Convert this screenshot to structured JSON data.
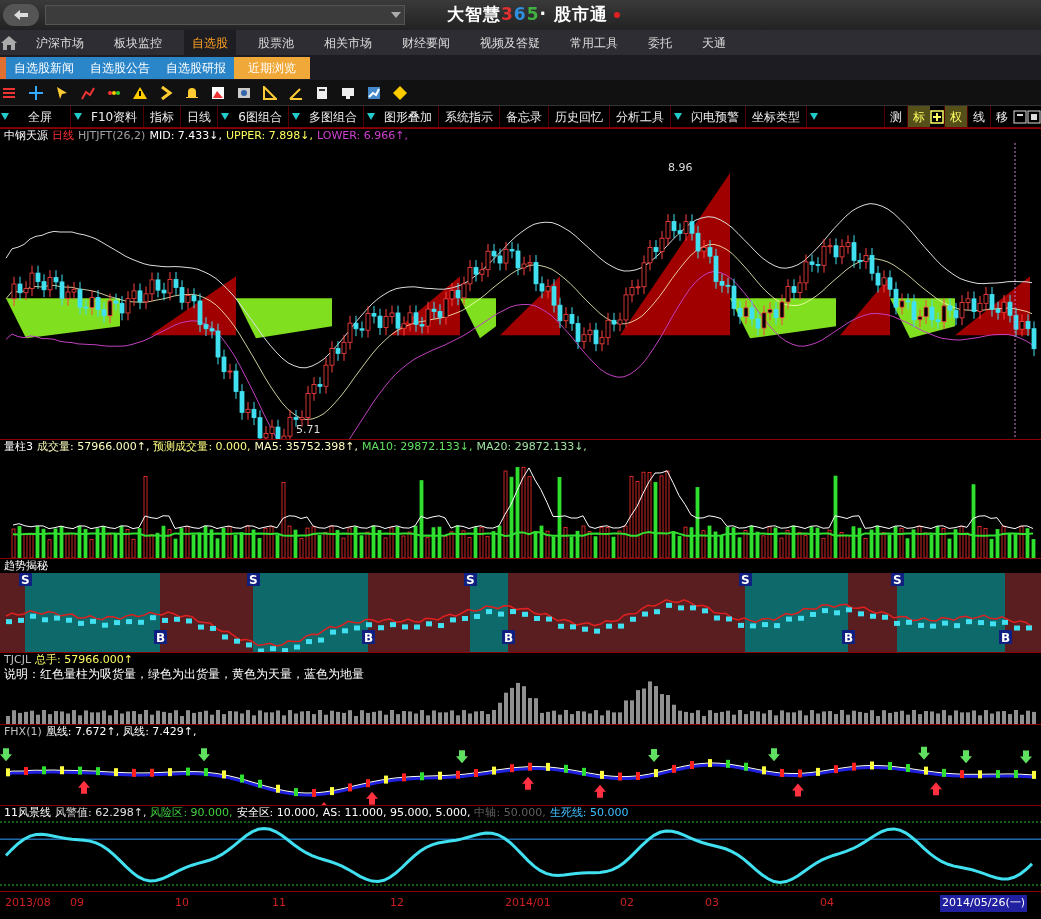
{
  "title_bar": {
    "brand": "大智慧",
    "brand_digits": "365",
    "brand_tail": "· 股市通"
  },
  "nav": [
    {
      "label": "沪深市场",
      "selected": false
    },
    {
      "label": "板块监控",
      "selected": false
    },
    {
      "label": "自选股",
      "selected": true
    },
    {
      "label": "股票池",
      "selected": false
    },
    {
      "label": "相关市场",
      "selected": false
    },
    {
      "label": "财经要闻",
      "selected": false
    },
    {
      "label": "视频及答疑",
      "selected": false
    },
    {
      "label": "常用工具",
      "selected": false
    },
    {
      "label": "委托",
      "selected": false
    },
    {
      "label": "天通",
      "selected": false
    }
  ],
  "subnav": [
    {
      "label": "自选股新闻",
      "selected": false
    },
    {
      "label": "自选股公告",
      "selected": false
    },
    {
      "label": "自选股研报",
      "selected": false
    },
    {
      "label": "近期浏览",
      "selected": true
    }
  ],
  "toolbar": [
    {
      "label": "全屏",
      "caret": true
    },
    {
      "label": "F10资料",
      "caret": false
    },
    {
      "label": "指标",
      "caret": false
    },
    {
      "label": "日线",
      "caret": true
    },
    {
      "label": "6图组合",
      "caret": true
    },
    {
      "label": "多图组合",
      "caret": true
    },
    {
      "label": "图形叠加",
      "caret": false
    },
    {
      "label": "系统指示",
      "caret": false
    },
    {
      "label": "备忘录",
      "caret": false
    },
    {
      "label": "历史回忆",
      "caret": false
    },
    {
      "label": "分析工具",
      "caret": true
    },
    {
      "label": "闪电预警",
      "caret": false
    },
    {
      "label": "坐标类型",
      "caret": true
    }
  ],
  "right_tools": [
    {
      "label": "测",
      "selected": false
    },
    {
      "label": "标",
      "selected": true
    },
    {
      "label": "权",
      "selected": true
    },
    {
      "label": "线",
      "selected": false
    },
    {
      "label": "移",
      "selected": false
    }
  ],
  "panels": [
    {
      "kind": "price",
      "legend": [
        "中钢天源",
        "日线",
        "HJTJFT(26,2)",
        "MID: 7.433↓,",
        "UPPER: 7.898↓,",
        "LOWER: 6.966↑,"
      ],
      "price_labels": [
        "8.96",
        "5.71"
      ]
    },
    {
      "kind": "volume",
      "legend": [
        "量柱3",
        "成交量: 57966.000↑,",
        "预测成交量: 0.000,",
        "MA5: 35752.398↑,",
        "MA10: 29872.133↓,",
        "MA20: 29872.133↓,"
      ]
    },
    {
      "kind": "trend",
      "legend": [
        "趋势揭秘"
      ],
      "markers": [
        "S",
        "B",
        "S",
        "B",
        "S",
        "B",
        "S",
        "B",
        "S",
        "B"
      ]
    },
    {
      "kind": "tjcjl",
      "legend": [
        "TJCJL",
        "总手: 57966.000↑"
      ],
      "note": "说明：红色量柱为吸货量，绿色为出货量，黄色为天量，蓝色为地量"
    },
    {
      "kind": "fhx",
      "legend": [
        "FHX(1)",
        "凰线: 7.672↑,",
        "凤线: 7.429↑,"
      ]
    },
    {
      "kind": "fengjing",
      "legend": [
        "11风景线",
        "风警值: 62.298↑,",
        "风险区: 90.000,",
        "安全区: 10.000,",
        "AS: 11.000, 95.000, 5.000,",
        "中轴: 50.000,",
        "生死线: 50.000"
      ]
    }
  ],
  "date_axis": [
    {
      "label": "2013/08",
      "selected": false
    },
    {
      "label": "09",
      "selected": false
    },
    {
      "label": "10",
      "selected": false
    },
    {
      "label": "11",
      "selected": false
    },
    {
      "label": "12",
      "selected": false
    },
    {
      "label": "2014/01",
      "selected": false
    },
    {
      "label": "02",
      "selected": false
    },
    {
      "label": "03",
      "selected": false
    },
    {
      "label": "04",
      "selected": false
    },
    {
      "label": "2014/05/26(一)",
      "selected": true
    }
  ]
}
